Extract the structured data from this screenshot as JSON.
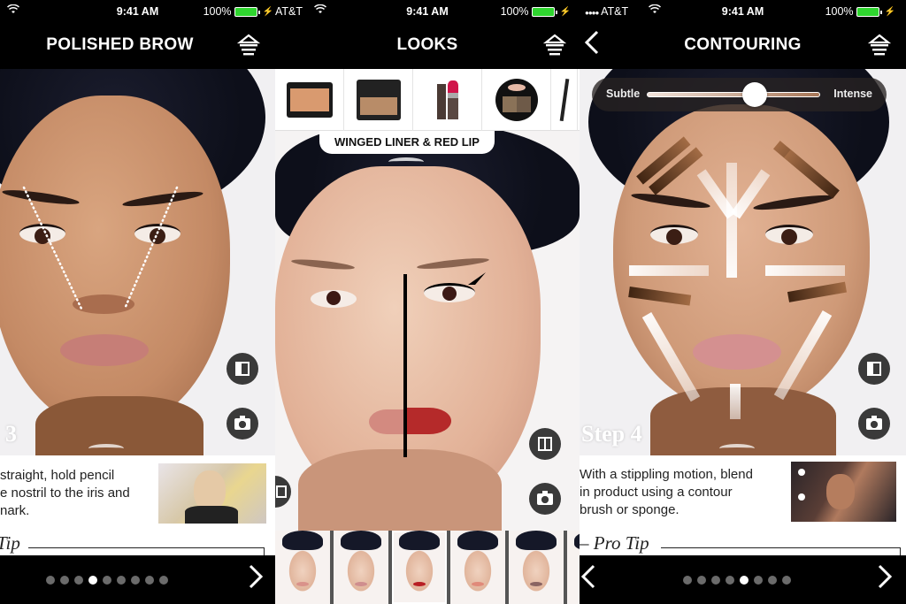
{
  "status_bar": {
    "carrier": "AT&T",
    "signal_dots": "●●●●",
    "time": "9:41 AM",
    "battery_percent": "100%",
    "battery_color": "#2fd52f"
  },
  "screens": [
    {
      "title": "POLISHED BROW",
      "step_label": "3",
      "instruction": "…straight, hold pencil\n…e nostril to the iris and\n…mark.",
      "instruction_lines": [
        "straight, hold pencil",
        "e nostril to the iris and",
        "nark."
      ],
      "pro_tip_label": "Tip",
      "pages": 9,
      "active_page": 4,
      "has_next": true,
      "has_back": false
    },
    {
      "title": "LOOKS",
      "look_name": "WINGED LINER & RED LIP",
      "products": [
        {
          "name": "blush-compact"
        },
        {
          "name": "bronzer-compact"
        },
        {
          "name": "lipstick"
        },
        {
          "name": "brow-powder-duo"
        },
        {
          "name": "eyeliner-pencil"
        }
      ],
      "look_thumbnails": [
        {
          "lip_color": "#d9928a"
        },
        {
          "lip_color": "#cf8e8e"
        },
        {
          "lip_color": "#b81e24",
          "selected": true
        },
        {
          "lip_color": "#e08a7a"
        },
        {
          "lip_color": "#8a6462"
        },
        {
          "lip_color": "#c98a84"
        }
      ]
    },
    {
      "title": "CONTOURING",
      "back_label": "<",
      "slider": {
        "min_label": "Subtle",
        "max_label": "Intense",
        "value_percent": 62
      },
      "step_label": "Step 4",
      "instruction_lines": [
        "With a stippling motion, blend",
        "in product using a contour",
        "brush or sponge."
      ],
      "pro_tip_label": "Pro Tip",
      "pages": 8,
      "active_page": 5,
      "has_next": true,
      "has_back": true
    }
  ],
  "icons": {
    "menu": "tray-menu-icon",
    "compare": "compare-icon",
    "camera": "camera-icon",
    "wifi": "wifi-icon",
    "chevron_next": "›",
    "chevron_back": "‹"
  }
}
